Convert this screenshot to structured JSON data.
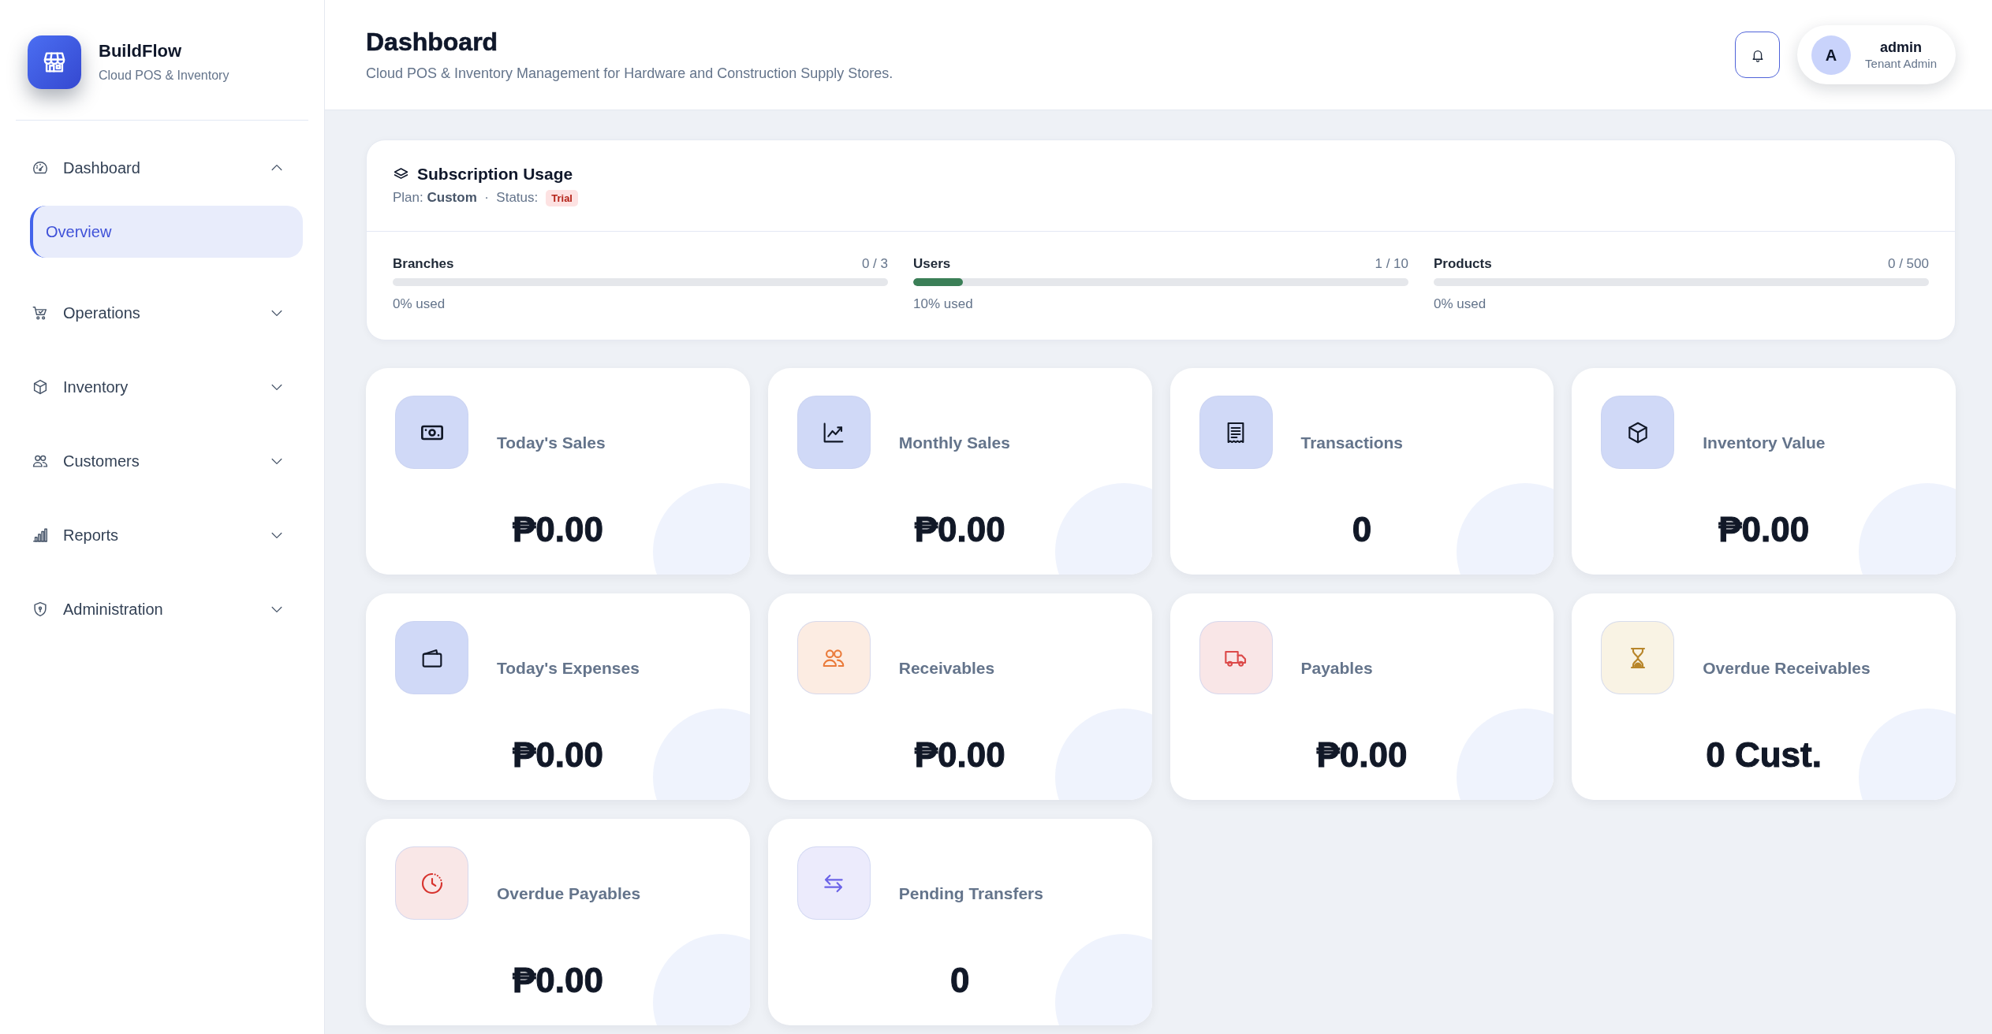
{
  "sidebar": {
    "brand": {
      "name": "BuildFlow",
      "tagline": "Cloud POS & Inventory"
    },
    "items": [
      {
        "label": "Dashboard",
        "expanded": true,
        "children": [
          {
            "label": "Overview",
            "selected": true
          }
        ]
      },
      {
        "label": "Operations",
        "expanded": false
      },
      {
        "label": "Inventory",
        "expanded": false
      },
      {
        "label": "Customers",
        "expanded": false
      },
      {
        "label": "Reports",
        "expanded": false
      },
      {
        "label": "Administration",
        "expanded": false
      }
    ]
  },
  "header": {
    "title": "Dashboard",
    "subtitle": "Cloud POS & Inventory Management for Hardware and Construction Supply Stores.",
    "user": {
      "initial": "A",
      "name": "admin",
      "role": "Tenant Admin"
    }
  },
  "subscription": {
    "title": "Subscription Usage",
    "plan_line": "Plan: **Custom**  ·  Status:",
    "status": "Trial",
    "meters": [
      {
        "name": "Branches",
        "count": "0 / 3",
        "level": 0,
        "note": "0% used"
      },
      {
        "name": "Users",
        "count": "1 / 10",
        "level": 0.1,
        "note": "10% used"
      },
      {
        "name": "Products",
        "count": "0 / 500",
        "level": 0,
        "note": "0% used"
      }
    ]
  },
  "stats": [
    {
      "label": "Today's Sales",
      "value": "₱0.00",
      "color": "#d0d9f7",
      "icon": {
        "color": "#111827"
      }
    },
    {
      "label": "Monthly Sales",
      "value": "₱0.00",
      "color": "#d0d9f7",
      "icon": {
        "color": "#111827"
      }
    },
    {
      "label": "Transactions",
      "value": "0",
      "color": "#d0d9f7",
      "icon": {
        "color": "#111827"
      }
    },
    {
      "label": "Inventory Value",
      "value": "₱0.00",
      "color": "#d0d9f7",
      "icon": {
        "color": "#111827"
      }
    },
    {
      "label": "Today's Expenses",
      "value": "₱0.00",
      "color": "#d0d9f7",
      "icon": {
        "color": "#111827"
      }
    },
    {
      "label": "Receivables",
      "value": "₱0.00",
      "color": "#fcece2",
      "icon": {
        "color": "#ea7a3a"
      }
    },
    {
      "label": "Payables",
      "value": "₱0.00",
      "color": "#f9e6e7",
      "icon": {
        "color": "#dc4a4a"
      }
    },
    {
      "label": "Overdue Receivables",
      "value": "0 Cust.",
      "color": "#f9f3e4",
      "icon": {
        "color": "#b8862b"
      }
    },
    {
      "label": "Overdue Payables",
      "value": "₱0.00",
      "color": "#f9e7e7",
      "icon": {
        "color": "#d7332e"
      }
    },
    {
      "label": "Pending Transfers",
      "value": "0",
      "color": "#ecebfc",
      "icon": {
        "color": "#6b63e8"
      }
    }
  ]
}
